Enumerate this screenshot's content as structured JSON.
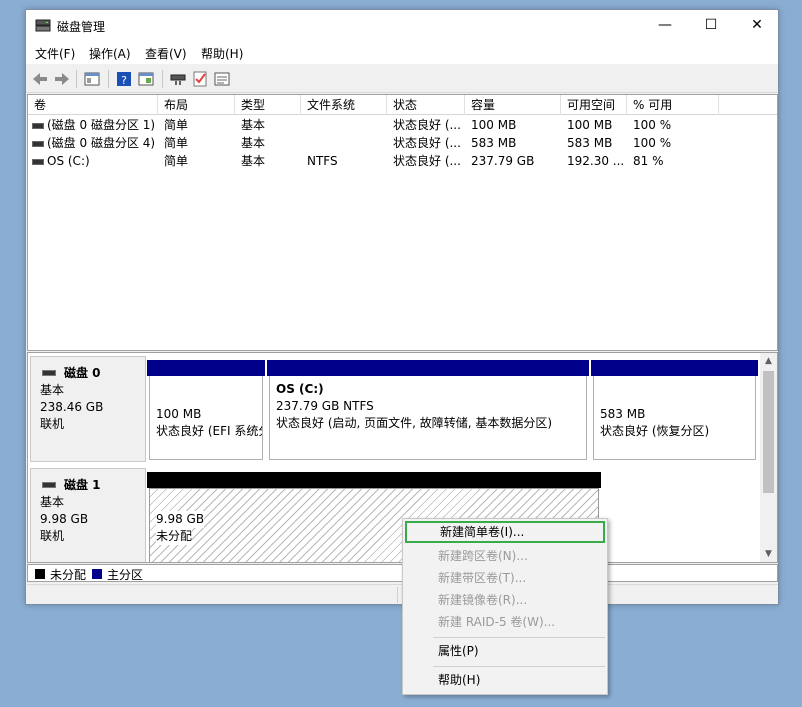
{
  "window": {
    "title": "磁盘管理",
    "buttons": {
      "minimize": "—",
      "maximize": "☐",
      "close": "✕"
    }
  },
  "menu": [
    "文件(F)",
    "操作(A)",
    "查看(V)",
    "帮助(H)"
  ],
  "toolbar_icons": [
    "back-icon",
    "forward-icon",
    "console-tree-icon",
    "help-icon",
    "properties-icon",
    "connect-icon",
    "check-icon",
    "settings-icon"
  ],
  "columns": [
    "卷",
    "布局",
    "类型",
    "文件系统",
    "状态",
    "容量",
    "可用空间",
    "% 可用"
  ],
  "volumes": [
    {
      "name": "(磁盘 0 磁盘分区 1)",
      "layout": "简单",
      "type": "基本",
      "fs": "",
      "status": "状态良好 (...",
      "capacity": "100 MB",
      "free": "100 MB",
      "pct": "100 %"
    },
    {
      "name": "(磁盘 0 磁盘分区 4)",
      "layout": "简单",
      "type": "基本",
      "fs": "",
      "status": "状态良好 (...",
      "capacity": "583 MB",
      "free": "583 MB",
      "pct": "100 %"
    },
    {
      "name": "OS (C:)",
      "layout": "简单",
      "type": "基本",
      "fs": "NTFS",
      "status": "状态良好 (...",
      "capacity": "237.79 GB",
      "free": "192.30 ...",
      "pct": "81 %"
    }
  ],
  "disks": [
    {
      "name": "磁盘 0",
      "kind": "基本",
      "size": "238.46 GB",
      "state": "联机",
      "partitions": [
        {
          "title": "",
          "line1": "100 MB",
          "line2": "状态良好 (EFI 系统分区)"
        },
        {
          "title": "OS  (C:)",
          "line1": "237.79 GB NTFS",
          "line2": "状态良好 (启动, 页面文件, 故障转储, 基本数据分区)"
        },
        {
          "title": "",
          "line1": "583 MB",
          "line2": "状态良好 (恢复分区)"
        }
      ]
    },
    {
      "name": "磁盘 1",
      "kind": "基本",
      "size": "9.98 GB",
      "state": "联机",
      "partitions": [
        {
          "title": "",
          "line1": "9.98 GB",
          "line2": "未分配"
        }
      ]
    }
  ],
  "legend": [
    {
      "label": "未分配",
      "color": "#000000"
    },
    {
      "label": "主分区",
      "color": "#00008b"
    }
  ],
  "context_menu": [
    {
      "label": "新建简单卷(I)...",
      "enabled": true,
      "highlighted": true
    },
    {
      "label": "新建跨区卷(N)...",
      "enabled": false
    },
    {
      "label": "新建带区卷(T)...",
      "enabled": false
    },
    {
      "label": "新建镜像卷(R)...",
      "enabled": false
    },
    {
      "label": "新建 RAID-5 卷(W)...",
      "enabled": false
    },
    {
      "label": "属性(P)",
      "enabled": true
    },
    {
      "label": "帮助(H)",
      "enabled": true
    }
  ],
  "colors": {
    "primary_partition": "#00008b",
    "unallocated": "#000000",
    "highlight_border": "#3aab4a"
  }
}
